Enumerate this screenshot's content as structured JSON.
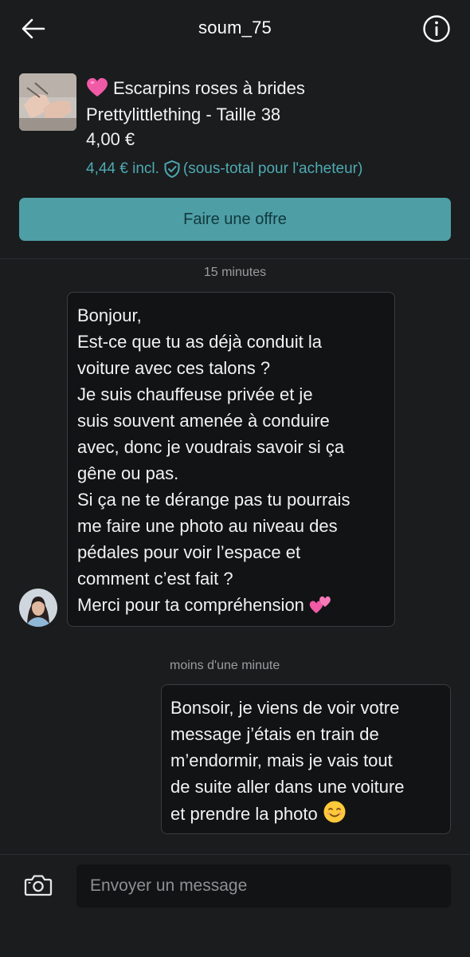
{
  "header": {
    "title": "soum_75",
    "back_icon": "arrow-left-icon",
    "info_icon": "info-circle-icon"
  },
  "product": {
    "title_emoji": "pink-heart-emoji",
    "title_lines": [
      "Escarpins roses à brides",
      "Prettylittlething - Taille 38"
    ],
    "price": "4,00 €",
    "price_incl": "4,44 € incl.",
    "protection_icon": "shield-check-icon",
    "price_incl_note": "(sous-total pour l'acheteur)"
  },
  "offer_button": {
    "label": "Faire une offre"
  },
  "messages": [
    {
      "timestamp": "15 minutes",
      "direction": "incoming",
      "lines": [
        "Bonjour,",
        "Est-ce que tu as déjà conduit la",
        "voiture avec ces talons ?",
        "Je suis chauffeuse privée et je",
        "suis souvent amenée à conduire",
        "avec, donc je voudrais savoir si ça",
        "gêne ou pas.",
        "Si ça ne te dérange pas tu pourrais",
        "me faire une photo au niveau des",
        "pédales pour voir l’espace et",
        "comment c’est fait ?",
        "Merci pour ta compréhension"
      ],
      "end_emoji": "two-hearts-emoji"
    },
    {
      "timestamp": "moins d'une minute",
      "direction": "outgoing",
      "lines": [
        "Bonsoir, je viens de voir votre",
        "message j’étais en train de",
        "m’endormir, mais je vais tout",
        "de suite aller dans une voiture",
        "et prendre la photo"
      ],
      "end_emoji": "smiling-face-emoji"
    }
  ],
  "composer": {
    "camera_icon": "camera-icon",
    "placeholder": "Envoyer un message"
  },
  "colors": {
    "background": "#1a1c1d",
    "accent": "#4e9ea6",
    "accent_text": "#4fa9b3",
    "bubble_bg": "#111314"
  }
}
